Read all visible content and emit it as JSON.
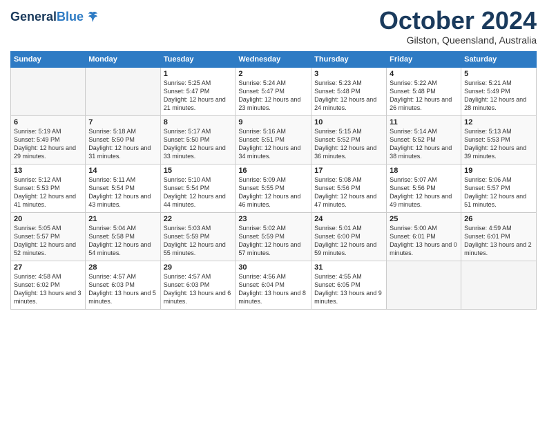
{
  "header": {
    "logo_line1": "General",
    "logo_line2": "Blue",
    "month_title": "October 2024",
    "location": "Gilston, Queensland, Australia"
  },
  "weekdays": [
    "Sunday",
    "Monday",
    "Tuesday",
    "Wednesday",
    "Thursday",
    "Friday",
    "Saturday"
  ],
  "weeks": [
    [
      {
        "day": "",
        "info": ""
      },
      {
        "day": "",
        "info": ""
      },
      {
        "day": "1",
        "info": "Sunrise: 5:25 AM\nSunset: 5:47 PM\nDaylight: 12 hours\nand 21 minutes."
      },
      {
        "day": "2",
        "info": "Sunrise: 5:24 AM\nSunset: 5:47 PM\nDaylight: 12 hours\nand 23 minutes."
      },
      {
        "day": "3",
        "info": "Sunrise: 5:23 AM\nSunset: 5:48 PM\nDaylight: 12 hours\nand 24 minutes."
      },
      {
        "day": "4",
        "info": "Sunrise: 5:22 AM\nSunset: 5:48 PM\nDaylight: 12 hours\nand 26 minutes."
      },
      {
        "day": "5",
        "info": "Sunrise: 5:21 AM\nSunset: 5:49 PM\nDaylight: 12 hours\nand 28 minutes."
      }
    ],
    [
      {
        "day": "6",
        "info": "Sunrise: 5:19 AM\nSunset: 5:49 PM\nDaylight: 12 hours\nand 29 minutes."
      },
      {
        "day": "7",
        "info": "Sunrise: 5:18 AM\nSunset: 5:50 PM\nDaylight: 12 hours\nand 31 minutes."
      },
      {
        "day": "8",
        "info": "Sunrise: 5:17 AM\nSunset: 5:50 PM\nDaylight: 12 hours\nand 33 minutes."
      },
      {
        "day": "9",
        "info": "Sunrise: 5:16 AM\nSunset: 5:51 PM\nDaylight: 12 hours\nand 34 minutes."
      },
      {
        "day": "10",
        "info": "Sunrise: 5:15 AM\nSunset: 5:52 PM\nDaylight: 12 hours\nand 36 minutes."
      },
      {
        "day": "11",
        "info": "Sunrise: 5:14 AM\nSunset: 5:52 PM\nDaylight: 12 hours\nand 38 minutes."
      },
      {
        "day": "12",
        "info": "Sunrise: 5:13 AM\nSunset: 5:53 PM\nDaylight: 12 hours\nand 39 minutes."
      }
    ],
    [
      {
        "day": "13",
        "info": "Sunrise: 5:12 AM\nSunset: 5:53 PM\nDaylight: 12 hours\nand 41 minutes."
      },
      {
        "day": "14",
        "info": "Sunrise: 5:11 AM\nSunset: 5:54 PM\nDaylight: 12 hours\nand 43 minutes."
      },
      {
        "day": "15",
        "info": "Sunrise: 5:10 AM\nSunset: 5:54 PM\nDaylight: 12 hours\nand 44 minutes."
      },
      {
        "day": "16",
        "info": "Sunrise: 5:09 AM\nSunset: 5:55 PM\nDaylight: 12 hours\nand 46 minutes."
      },
      {
        "day": "17",
        "info": "Sunrise: 5:08 AM\nSunset: 5:56 PM\nDaylight: 12 hours\nand 47 minutes."
      },
      {
        "day": "18",
        "info": "Sunrise: 5:07 AM\nSunset: 5:56 PM\nDaylight: 12 hours\nand 49 minutes."
      },
      {
        "day": "19",
        "info": "Sunrise: 5:06 AM\nSunset: 5:57 PM\nDaylight: 12 hours\nand 51 minutes."
      }
    ],
    [
      {
        "day": "20",
        "info": "Sunrise: 5:05 AM\nSunset: 5:57 PM\nDaylight: 12 hours\nand 52 minutes."
      },
      {
        "day": "21",
        "info": "Sunrise: 5:04 AM\nSunset: 5:58 PM\nDaylight: 12 hours\nand 54 minutes."
      },
      {
        "day": "22",
        "info": "Sunrise: 5:03 AM\nSunset: 5:59 PM\nDaylight: 12 hours\nand 55 minutes."
      },
      {
        "day": "23",
        "info": "Sunrise: 5:02 AM\nSunset: 5:59 PM\nDaylight: 12 hours\nand 57 minutes."
      },
      {
        "day": "24",
        "info": "Sunrise: 5:01 AM\nSunset: 6:00 PM\nDaylight: 12 hours\nand 59 minutes."
      },
      {
        "day": "25",
        "info": "Sunrise: 5:00 AM\nSunset: 6:01 PM\nDaylight: 13 hours\nand 0 minutes."
      },
      {
        "day": "26",
        "info": "Sunrise: 4:59 AM\nSunset: 6:01 PM\nDaylight: 13 hours\nand 2 minutes."
      }
    ],
    [
      {
        "day": "27",
        "info": "Sunrise: 4:58 AM\nSunset: 6:02 PM\nDaylight: 13 hours\nand 3 minutes."
      },
      {
        "day": "28",
        "info": "Sunrise: 4:57 AM\nSunset: 6:03 PM\nDaylight: 13 hours\nand 5 minutes."
      },
      {
        "day": "29",
        "info": "Sunrise: 4:57 AM\nSunset: 6:03 PM\nDaylight: 13 hours\nand 6 minutes."
      },
      {
        "day": "30",
        "info": "Sunrise: 4:56 AM\nSunset: 6:04 PM\nDaylight: 13 hours\nand 8 minutes."
      },
      {
        "day": "31",
        "info": "Sunrise: 4:55 AM\nSunset: 6:05 PM\nDaylight: 13 hours\nand 9 minutes."
      },
      {
        "day": "",
        "info": ""
      },
      {
        "day": "",
        "info": ""
      }
    ]
  ]
}
